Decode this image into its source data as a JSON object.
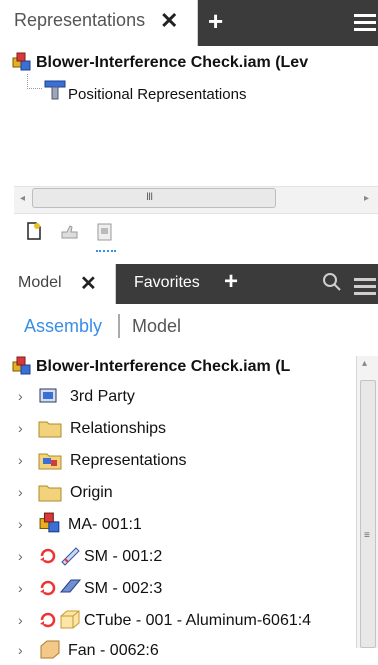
{
  "top_panel": {
    "tab_label": "Representations",
    "root_label": "Blower-Interference Check.iam (Lev",
    "child_label": "Positional Representations"
  },
  "scrollbar": {
    "grip": "III"
  },
  "model_panel": {
    "tab_model": "Model",
    "tab_favorites": "Favorites",
    "view_assembly": "Assembly",
    "view_model": "Model",
    "root_label": "Blower-Interference Check.iam (L",
    "items": [
      {
        "label": "3rd Party",
        "icon": "third-party-icon"
      },
      {
        "label": "Relationships",
        "icon": "folder-icon"
      },
      {
        "label": "Representations",
        "icon": "representations-icon"
      },
      {
        "label": "Origin",
        "icon": "folder-icon"
      },
      {
        "label": "MA- 001:1",
        "icon": "assembly-icon"
      },
      {
        "label": "SM - 001:2",
        "icon": "sheetmetal-part-icon"
      },
      {
        "label": "SM - 002:3",
        "icon": "sheetmetal-part-icon"
      },
      {
        "label": "CTube - 001 - Aluminum-6061:4",
        "icon": "tube-part-icon"
      },
      {
        "label": "Fan - 0062:6",
        "icon": "fan-part-icon"
      }
    ]
  },
  "colors": {
    "accent": "#3a8ee6",
    "dark_bar": "#3b3b3b",
    "folder": "#f2d27a"
  }
}
